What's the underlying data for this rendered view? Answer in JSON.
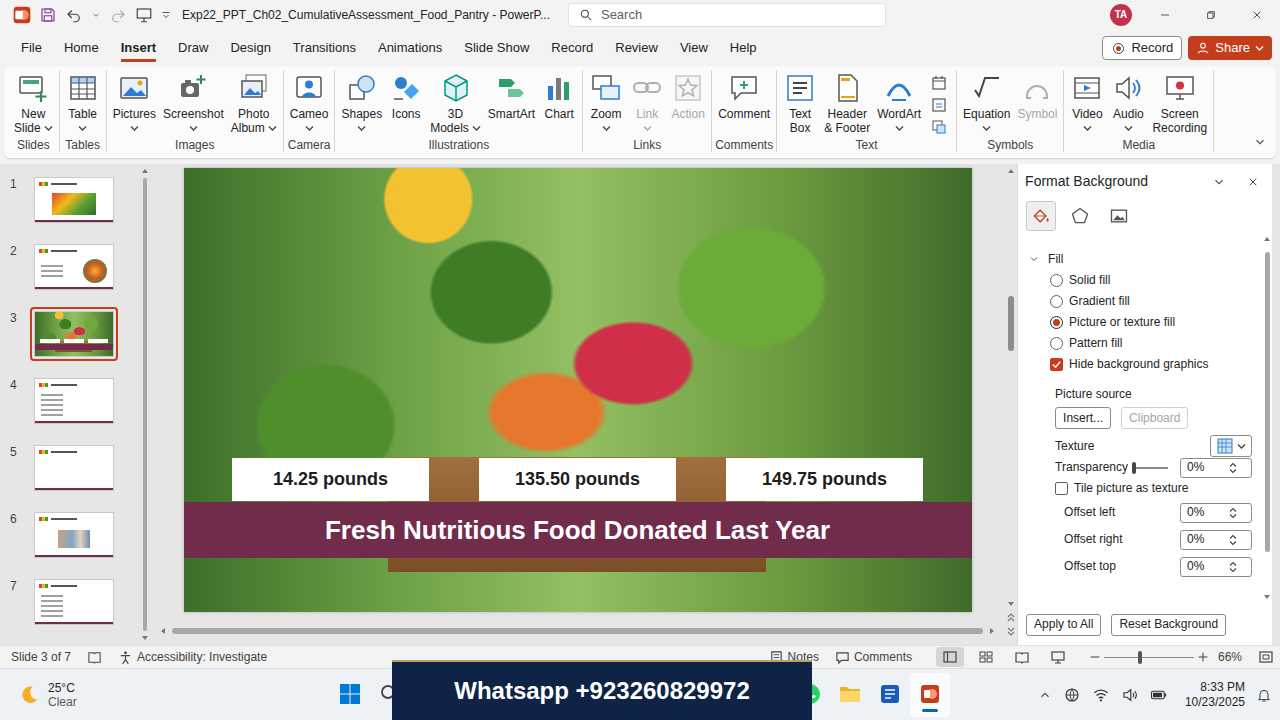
{
  "window": {
    "title": "Exp22_PPT_Ch02_CumulativeAssessment_Food_Pantry - PowerP...",
    "search": {
      "placeholder": "Search"
    },
    "account": "TA"
  },
  "menu_tabs": [
    {
      "label": "File",
      "selected": false
    },
    {
      "label": "Home",
      "selected": false
    },
    {
      "label": "Insert",
      "selected": true
    },
    {
      "label": "Draw",
      "selected": false
    },
    {
      "label": "Design",
      "selected": false
    },
    {
      "label": "Transitions",
      "selected": false
    },
    {
      "label": "Animations",
      "selected": false
    },
    {
      "label": "Slide Show",
      "selected": false
    },
    {
      "label": "Record",
      "selected": false
    },
    {
      "label": "Review",
      "selected": false
    },
    {
      "label": "View",
      "selected": false
    },
    {
      "label": "Help",
      "selected": false
    }
  ],
  "header_buttons": {
    "record": "Record",
    "share": "Share"
  },
  "ribbon": {
    "groups": [
      {
        "label": "Slides",
        "buttons": [
          {
            "lines": [
              "New",
              "Slide"
            ],
            "dropdown": true,
            "disabled": false
          }
        ]
      },
      {
        "label": "Tables",
        "buttons": [
          {
            "lines": [
              "Table"
            ],
            "dropdown": true,
            "disabled": false
          }
        ]
      },
      {
        "label": "Images",
        "buttons": [
          {
            "lines": [
              "Pictures"
            ],
            "dropdown": true,
            "disabled": false
          },
          {
            "lines": [
              "Screenshot"
            ],
            "dropdown": true,
            "disabled": false
          },
          {
            "lines": [
              "Photo",
              "Album"
            ],
            "dropdown": true,
            "disabled": false
          }
        ]
      },
      {
        "label": "Camera",
        "buttons": [
          {
            "lines": [
              "Cameo"
            ],
            "dropdown": true,
            "disabled": false
          }
        ]
      },
      {
        "label": "Illustrations",
        "buttons": [
          {
            "lines": [
              "Shapes"
            ],
            "dropdown": true,
            "disabled": false
          },
          {
            "lines": [
              "Icons"
            ],
            "dropdown": false,
            "disabled": false
          },
          {
            "lines": [
              "3D",
              "Models"
            ],
            "dropdown": true,
            "disabled": false
          },
          {
            "lines": [
              "SmartArt"
            ],
            "dropdown": false,
            "disabled": false
          },
          {
            "lines": [
              "Chart"
            ],
            "dropdown": false,
            "disabled": false
          }
        ]
      },
      {
        "label": "Links",
        "buttons": [
          {
            "lines": [
              "Zoom"
            ],
            "dropdown": true,
            "disabled": false
          },
          {
            "lines": [
              "Link"
            ],
            "dropdown": true,
            "disabled": true
          },
          {
            "lines": [
              "Action"
            ],
            "dropdown": false,
            "disabled": true
          }
        ]
      },
      {
        "label": "Comments",
        "buttons": [
          {
            "lines": [
              "Comment"
            ],
            "dropdown": false,
            "disabled": false
          }
        ]
      },
      {
        "label": "Text",
        "buttons": [
          {
            "lines": [
              "Text",
              "Box"
            ],
            "dropdown": false,
            "disabled": false
          },
          {
            "lines": [
              "Header",
              "& Footer"
            ],
            "dropdown": false,
            "disabled": false
          },
          {
            "lines": [
              "WordArt"
            ],
            "dropdown": true,
            "disabled": false
          }
        ],
        "mini_buttons": [
          {
            "disabled": false
          },
          {
            "disabled": false
          },
          {
            "disabled": false
          }
        ]
      },
      {
        "label": "Symbols",
        "buttons": [
          {
            "lines": [
              "Equation"
            ],
            "dropdown": true,
            "disabled": false
          },
          {
            "lines": [
              "Symbol"
            ],
            "dropdown": false,
            "disabled": true
          }
        ]
      },
      {
        "label": "Media",
        "buttons": [
          {
            "lines": [
              "Video"
            ],
            "dropdown": true,
            "disabled": false
          },
          {
            "lines": [
              "Audio"
            ],
            "dropdown": true,
            "disabled": false
          },
          {
            "lines": [
              "Screen",
              "Recording"
            ],
            "dropdown": false,
            "disabled": false
          }
        ]
      }
    ]
  },
  "thumbnails": [
    {
      "number": "1",
      "selected": false,
      "kind": "title-photo"
    },
    {
      "number": "2",
      "selected": false,
      "kind": "photo-circle"
    },
    {
      "number": "3",
      "selected": true,
      "kind": "photo"
    },
    {
      "number": "4",
      "selected": false,
      "kind": "list"
    },
    {
      "number": "5",
      "selected": false,
      "kind": "title-only"
    },
    {
      "number": "6",
      "selected": false,
      "kind": "photo-center"
    },
    {
      "number": "7",
      "selected": false,
      "kind": "list"
    }
  ],
  "slide": {
    "stats": [
      "14.25 pounds",
      "135.50 pounds",
      "149.75 pounds"
    ],
    "banner": "Fresh Nutritious Food Donated Last Year"
  },
  "format_pane": {
    "title": "Format Background",
    "tabs": [
      {
        "selected": true
      },
      {
        "selected": false
      },
      {
        "selected": false
      }
    ],
    "section": {
      "label": "Fill",
      "expanded": true
    },
    "fill_options": [
      {
        "label": "Solid fill",
        "selected": false
      },
      {
        "label": "Gradient fill",
        "selected": false
      },
      {
        "label": "Picture or texture fill",
        "selected": true
      },
      {
        "label": "Pattern fill",
        "selected": false
      }
    ],
    "hide_graphics": {
      "label": "Hide background graphics",
      "checked": true
    },
    "picture_source": "Picture source",
    "source_buttons": [
      {
        "label": "Insert...",
        "disabled": false
      },
      {
        "label": "Clipboard",
        "disabled": true
      }
    ],
    "texture": "Texture",
    "transparency": {
      "label": "Transparency",
      "level": 0,
      "value": "0%"
    },
    "tile": {
      "label": "Tile picture as texture",
      "checked": false
    },
    "offsets": [
      {
        "label": "Offset left",
        "value": "0%"
      },
      {
        "label": "Offset right",
        "value": "0%"
      },
      {
        "label": "Offset top",
        "value": "0%"
      }
    ],
    "footer_buttons": [
      "Apply to All",
      "Reset Background"
    ]
  },
  "status_bar": {
    "slide": "Slide 3 of 7",
    "accessibility": "Accessibility: Investigate",
    "notes": "Notes",
    "comments": "Comments",
    "views": [
      {
        "selected": true
      },
      {
        "selected": false
      },
      {
        "selected": false
      },
      {
        "selected": false
      }
    ],
    "zoom": {
      "level": 0.4,
      "value": "66%"
    }
  },
  "taskbar": {
    "weather": {
      "temperature": "25°C",
      "condition": "Clear"
    },
    "apps_left": [
      {
        "kind": "start",
        "selected": false
      },
      {
        "kind": "search",
        "selected": false
      }
    ],
    "apps_right": [
      {
        "kind": "whatsapp",
        "selected": false
      },
      {
        "kind": "explorer",
        "selected": false
      },
      {
        "kind": "word",
        "selected": false
      },
      {
        "kind": "powerpoint",
        "selected": true
      }
    ],
    "clock": {
      "time": "8:33 PM",
      "date": "10/23/2025"
    }
  },
  "watermark": "Whatsapp +923260829972"
}
